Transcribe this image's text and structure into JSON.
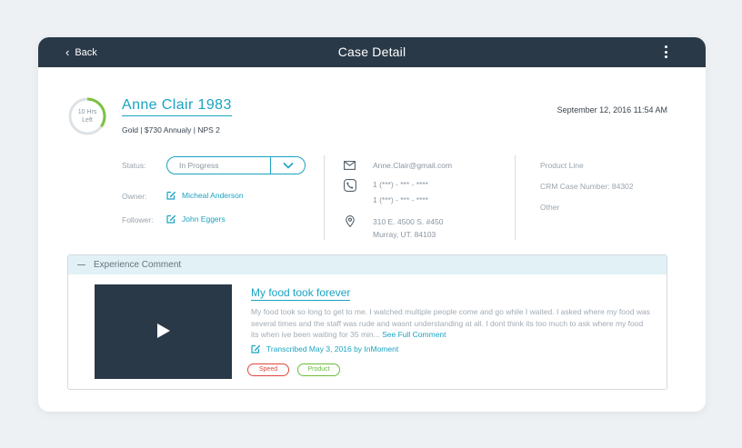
{
  "header": {
    "back_label": "Back",
    "title": "Case Detail"
  },
  "customer": {
    "time_left_value": "10 Hrs",
    "time_left_unit": "Left",
    "time_left_progress": 0.35,
    "name": "Anne Clair 1983",
    "subinfo": "Gold | $730 Annualy | NPS 2",
    "datetime": "September 12, 2016 11:54 AM"
  },
  "case": {
    "status_label": "Status:",
    "status_value": "In Progress",
    "owner_label": "Owner:",
    "owner_value": "Micheal Anderson",
    "follower_label": "Follower:",
    "follower_value": "John Eggers"
  },
  "contact": {
    "email": "Anne.Clair@gmail.com",
    "phone1": "1 (***) - *** - ****",
    "phone2": "1 (***) - *** - ****",
    "address_line1": "310 E. 4500 S. #450",
    "address_line2": "Murray, UT. 84103"
  },
  "product": {
    "line": "Product Line",
    "crm_case": "CRM Case Number: 84302",
    "other": "Other"
  },
  "experience": {
    "section_title": "Experience Comment",
    "comment_title": "My food took forever",
    "comment_body": "My food took so long to get to me. I watched multiple people come and go while I waited. I asked where my food was several times and the staff was rude and wasnt understanding at all. I dont think its too much to ask where my food its when ive been waiting for 35 min...",
    "see_full_label": "See Full Comment",
    "transcribed": "Transcribed May 3, 2016 by InMoment",
    "tags": [
      "Speed",
      "Product"
    ]
  },
  "colors": {
    "accent": "#1aa3c2",
    "header_bg": "#2a3948",
    "ring_progress": "#7cc242",
    "tag_speed": "#e0473d",
    "tag_product": "#6dbb3c"
  }
}
